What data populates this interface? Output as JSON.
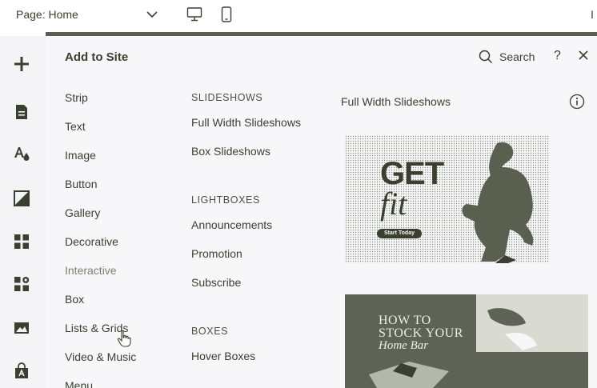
{
  "topbar": {
    "page_prefix": "Page: ",
    "page_name": "Home",
    "edge_text": "I"
  },
  "rail": {
    "icons": [
      "plus-icon",
      "page-icon",
      "theme-icon",
      "background-icon",
      "apps-grid-icon",
      "puzzle-icon",
      "image-icon",
      "market-icon"
    ]
  },
  "panel": {
    "title": "Add to Site",
    "search_label": "Search",
    "help_label": "?",
    "categories": [
      {
        "label": "Strip",
        "muted": false
      },
      {
        "label": "Text",
        "muted": false
      },
      {
        "label": "Image",
        "muted": false
      },
      {
        "label": "Button",
        "muted": false
      },
      {
        "label": "Gallery",
        "muted": false
      },
      {
        "label": "Decorative",
        "muted": false
      },
      {
        "label": "Interactive",
        "muted": true
      },
      {
        "label": "Box",
        "muted": false
      },
      {
        "label": "Lists & Grids",
        "muted": false
      },
      {
        "label": "Video & Music",
        "muted": false
      },
      {
        "label": "Menu",
        "muted": false
      }
    ],
    "sections": [
      {
        "header": "SLIDESHOWS",
        "items": [
          "Full Width Slideshows",
          "Box Slideshows"
        ]
      },
      {
        "header": "LIGHTBOXES",
        "items": [
          "Announcements",
          "Promotion",
          "Subscribe"
        ]
      },
      {
        "header": "BOXES",
        "items": [
          "Hover Boxes"
        ]
      }
    ],
    "preview_title": "Full Width Slideshows",
    "preview1": {
      "headline": "GET",
      "subline": "fit",
      "cta": "Start Today"
    },
    "preview2": {
      "line1": "HOW TO",
      "line2": "STOCK YOUR",
      "line3": "Home Bar"
    }
  },
  "colors": {
    "ink": "#3a4030",
    "olive": "#5a6050",
    "panel": "#f7f7f9"
  }
}
